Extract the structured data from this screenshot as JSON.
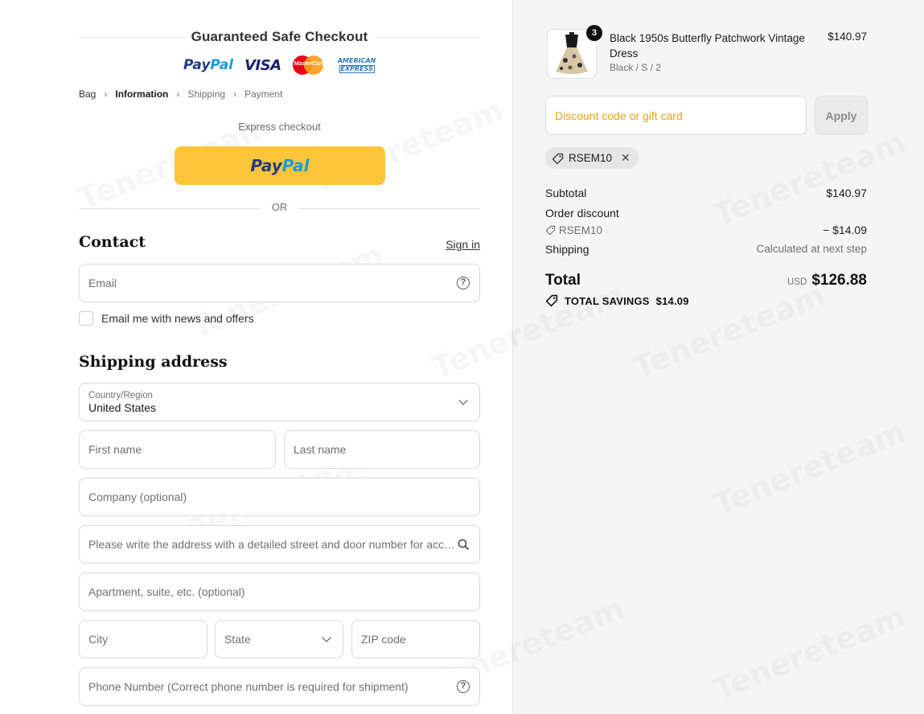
{
  "header": {
    "guarantee_title": "Guaranteed Safe Checkout",
    "payment_logos": [
      "PayPal",
      "VISA",
      "MasterCard",
      "AMERICAN EXPRESS"
    ]
  },
  "breadcrumb": {
    "items": [
      {
        "label": "Bag",
        "state": "link"
      },
      {
        "label": "Information",
        "state": "active"
      },
      {
        "label": "Shipping",
        "state": "upcoming"
      },
      {
        "label": "Payment",
        "state": "upcoming"
      }
    ]
  },
  "express": {
    "label": "Express checkout",
    "paypal_part1": "Pay",
    "paypal_part2": "Pal",
    "or_label": "OR"
  },
  "contact": {
    "heading": "Contact",
    "sign_in": "Sign in",
    "email_placeholder": "Email",
    "newsletter_label": "Email me with news and offers"
  },
  "shipping": {
    "heading": "Shipping address",
    "country_label": "Country/Region",
    "country_value": "United States",
    "first_name": "First name",
    "last_name": "Last name",
    "company": "Company (optional)",
    "address": "Please write the address with a detailed street and door number for accu...",
    "apartment": "Apartment, suite, etc. (optional)",
    "city": "City",
    "state": "State",
    "zip": "ZIP code",
    "phone": "Phone Number (Correct phone number is required for shipment)"
  },
  "cart": {
    "item": {
      "name": "Black 1950s Butterfly Patchwork Vintage Dress",
      "variant": "Black / S / 2",
      "price": "$140.97",
      "quantity": "3"
    },
    "discount_placeholder": "Discount code or gift card",
    "apply_label": "Apply",
    "applied_code": "RSEM10"
  },
  "summary": {
    "subtotal_label": "Subtotal",
    "subtotal_value": "$140.97",
    "order_discount_label": "Order discount",
    "discount_code": "RSEM10",
    "discount_value": "− $14.09",
    "shipping_label": "Shipping",
    "shipping_value": "Calculated at next step",
    "total_label": "Total",
    "currency": "USD",
    "total_value": "$126.88",
    "savings_label": "TOTAL SAVINGS",
    "savings_value": "$14.09"
  },
  "colors": {
    "paypal_yellow": "#ffc439",
    "paypal_dark_blue": "#253b80",
    "paypal_light_blue": "#179bd7",
    "discount_placeholder": "#e6a312",
    "right_panel_bg": "#f5f5f5"
  },
  "watermark": "Tenereteam"
}
